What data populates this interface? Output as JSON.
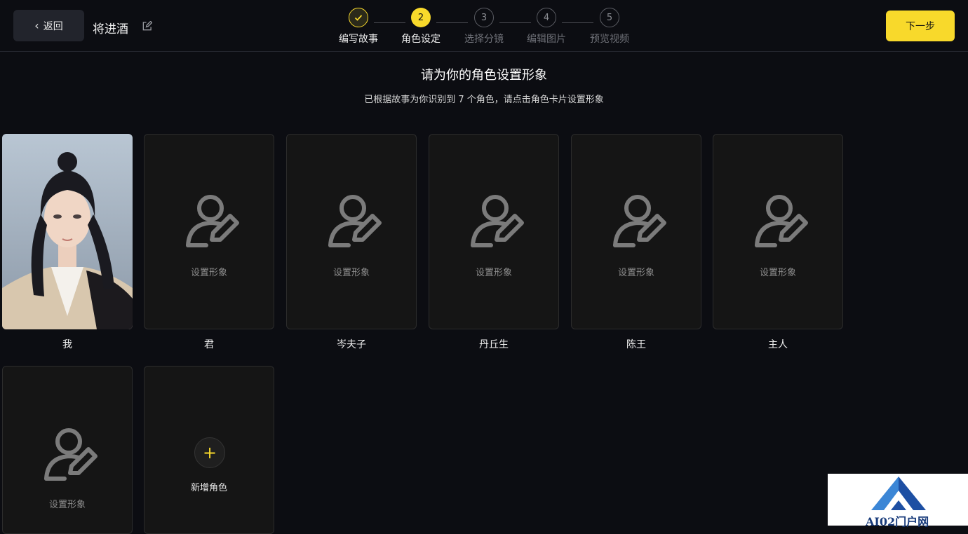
{
  "header": {
    "back_label": "返回",
    "project_title": "将进酒",
    "next_label": "下一步"
  },
  "steps": [
    {
      "number": "1",
      "label": "编写故事",
      "status": "done"
    },
    {
      "number": "2",
      "label": "角色设定",
      "status": "active"
    },
    {
      "number": "3",
      "label": "选择分镜",
      "status": "pending"
    },
    {
      "number": "4",
      "label": "编辑图片",
      "status": "pending"
    },
    {
      "number": "5",
      "label": "预览视频",
      "status": "pending"
    }
  ],
  "main": {
    "heading": "请为你的角色设置形象",
    "subheading": "已根据故事为你识别到 7 个角色，请点击角色卡片设置形象"
  },
  "characters": [
    {
      "name": "我",
      "has_image": true
    },
    {
      "name": "君",
      "set_label": "设置形象"
    },
    {
      "name": "岑夫子",
      "set_label": "设置形象"
    },
    {
      "name": "丹丘生",
      "set_label": "设置形象"
    },
    {
      "name": "陈王",
      "set_label": "设置形象"
    },
    {
      "name": "主人",
      "set_label": "设置形象"
    },
    {
      "name": "",
      "set_label": "设置形象"
    }
  ],
  "add_card": {
    "label": "新增角色"
  },
  "watermark": {
    "text": "AI02门户网"
  },
  "colors": {
    "accent": "#f8d92b",
    "background": "#0c0d12",
    "card": "#151515"
  },
  "icons": {
    "back": "chevron-left-icon",
    "edit": "edit-icon",
    "user": "user-edit-icon",
    "add": "plus-icon",
    "check": "check-icon"
  }
}
